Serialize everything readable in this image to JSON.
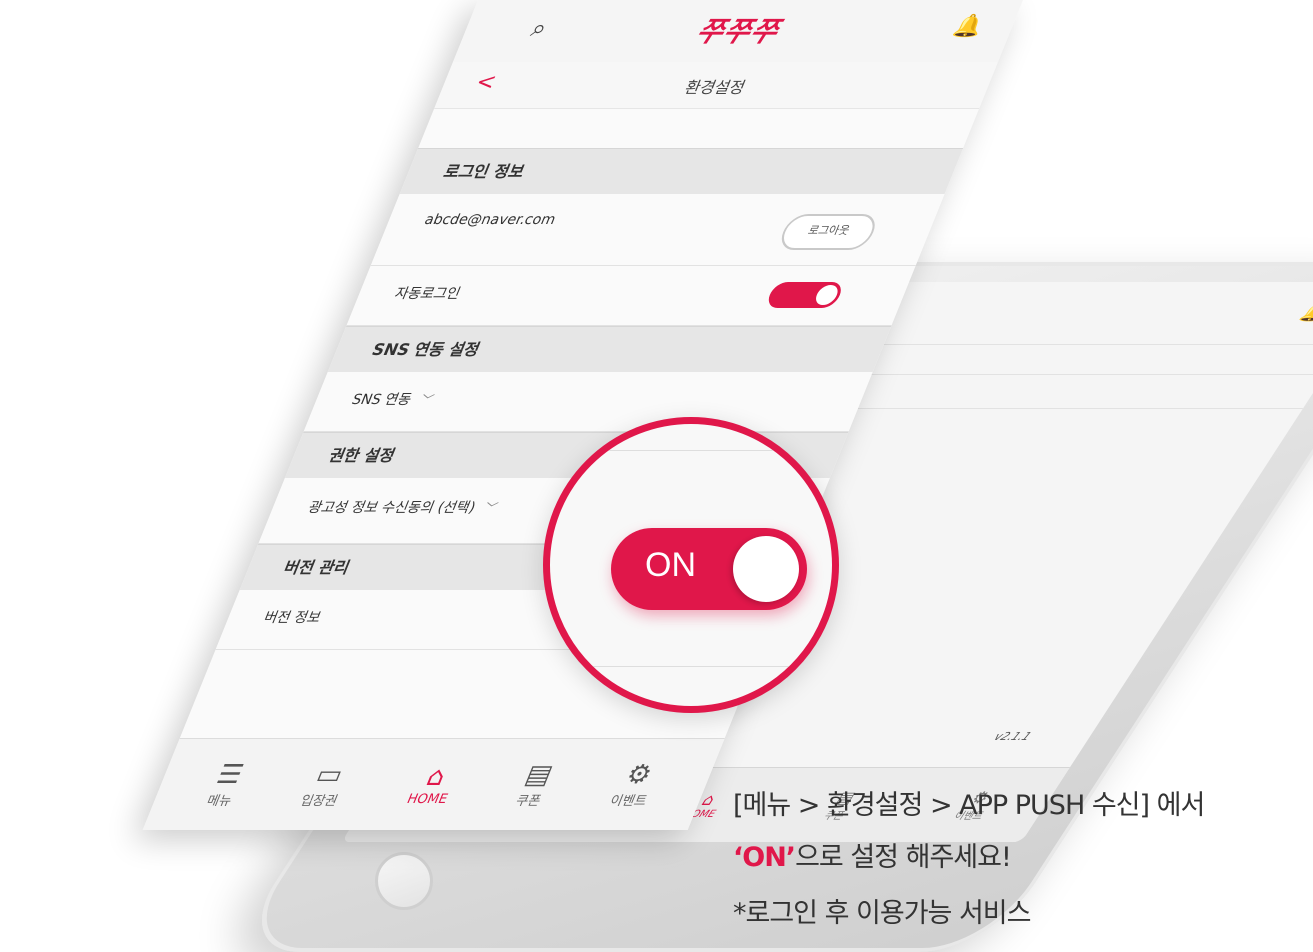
{
  "app": {
    "logo_text": "쭈쭈쭈",
    "accent_color": "#e0174a",
    "top_icons": {
      "left": "search-icon",
      "right": "bell-icon"
    }
  },
  "subheader": {
    "title": "환경설정",
    "back_icon": "chevron-left-icon"
  },
  "sections": {
    "login": {
      "title": "로그인 정보",
      "email": "abcde@naver.com",
      "logout_label": "로그아웃",
      "auto_login_label": "자동로그인",
      "auto_login_on": true
    },
    "sns": {
      "title": "SNS 연동 설정",
      "item_label": "SNS 연동"
    },
    "permission": {
      "title": "권한 설정",
      "item_label": "광고성 정보 수신동의 (선택)"
    },
    "version": {
      "title": "버전 관리",
      "item_label": "버전 정보",
      "value": "v2.1.1"
    }
  },
  "tabbar": [
    {
      "label": "메뉴",
      "icon": "menu-icon",
      "active": false
    },
    {
      "label": "입장권",
      "icon": "ticket-icon",
      "active": false
    },
    {
      "label": "HOME",
      "icon": "store-icon",
      "active": true
    },
    {
      "label": "쿠폰",
      "icon": "coupon-icon",
      "active": false
    },
    {
      "label": "이벤트",
      "icon": "event-gear-icon",
      "active": false
    }
  ],
  "magnified_toggle": {
    "label": "ON",
    "state_on": true
  },
  "instructions": {
    "line1": "[메뉴 > 환경설정 > APP PUSH 수신] 에서",
    "line2_highlight": "‘ON’",
    "line2_rest": "으로 설정 해주세요!",
    "line3": "*로그인 후 이용가능 서비스"
  }
}
